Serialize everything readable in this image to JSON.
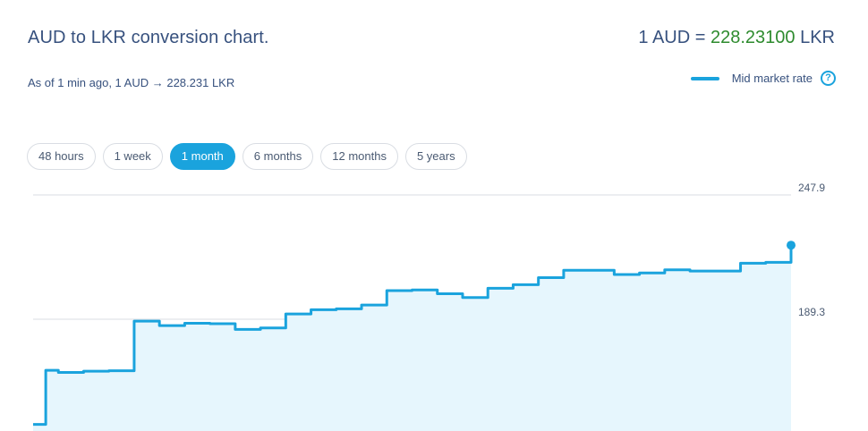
{
  "header": {
    "title": "AUD to LKR conversion chart.",
    "rate_prefix": "1 AUD = ",
    "rate_value": "228.23100",
    "rate_suffix": " LKR",
    "as_of": "As of 1 min ago, 1 AUD → 228.231 LKR"
  },
  "legend": {
    "label": "Mid market rate",
    "help_icon": "?"
  },
  "tabs": [
    {
      "label": "48 hours",
      "active": false
    },
    {
      "label": "1 week",
      "active": false
    },
    {
      "label": "1 month",
      "active": true
    },
    {
      "label": "6 months",
      "active": false
    },
    {
      "label": "12 months",
      "active": false
    },
    {
      "label": "5 years",
      "active": false
    }
  ],
  "colors": {
    "line": "#1aa3dd",
    "fill": "#e6f6fd",
    "grid": "#d9dde3",
    "text": "#37517e",
    "rate": "#2e8b2e"
  },
  "chart_data": {
    "type": "area",
    "y_tick_labels": [
      "247.9",
      "189.3"
    ],
    "y_ticks": [
      247.9,
      189.3
    ],
    "ylim": [
      136.6,
      247.9
    ],
    "x": [
      0,
      0.5,
      1,
      2,
      3,
      4,
      5,
      6,
      7,
      8,
      9,
      10,
      11,
      12,
      13,
      14,
      15,
      16,
      17,
      18,
      19,
      20,
      21,
      22,
      23,
      24,
      25,
      26,
      27,
      28,
      29,
      30
    ],
    "values": [
      139.7,
      165.2,
      164.2,
      164.8,
      165.0,
      188.4,
      186.3,
      187.4,
      187.2,
      184.5,
      185.2,
      191.8,
      193.8,
      194.2,
      196.0,
      202.8,
      203.1,
      201.3,
      199.5,
      203.9,
      205.6,
      208.9,
      212.4,
      212.4,
      210.4,
      211.1,
      212.6,
      212.0,
      212.0,
      215.7,
      216.1,
      224.2
    ],
    "title": "",
    "xlabel": "",
    "ylabel": "",
    "grid": true,
    "legend_position": "top-right"
  }
}
